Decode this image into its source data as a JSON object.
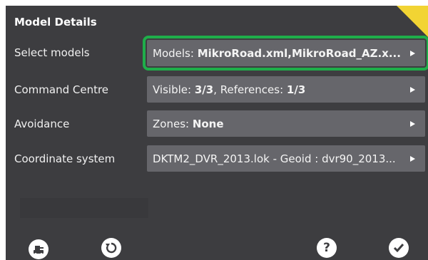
{
  "screen": {
    "title": "Model Details"
  },
  "rows": [
    {
      "label": "Select models",
      "value_prefix": "Models: ",
      "value_bold": "MikroRoad.xml,MikroRoad_AZ.x...",
      "value_mid": "",
      "value_bold2": ""
    },
    {
      "label": "Command Centre",
      "value_prefix": "Visible: ",
      "value_bold": "3/3",
      "value_mid": ", References: ",
      "value_bold2": "1/3"
    },
    {
      "label": "Avoidance",
      "value_prefix": "Zones: ",
      "value_bold": "None",
      "value_mid": "",
      "value_bold2": ""
    },
    {
      "label": "Coordinate system",
      "value_prefix": "DKTM2_DVR_2013.lok - Geoid : dvr90_2013...",
      "value_bold": "",
      "value_mid": "",
      "value_bold2": ""
    }
  ],
  "toolbar": {
    "left1_icon": "machine-icon",
    "left2_icon": "refresh-icon",
    "help_icon": "help-icon",
    "confirm_icon": "check-icon"
  },
  "colors": {
    "background": "#3d3d40",
    "field": "#66666b",
    "selected_outline": "#1fae4a",
    "corner_accent": "#f2d433"
  }
}
